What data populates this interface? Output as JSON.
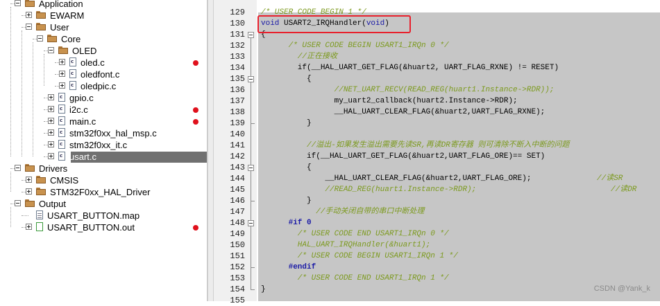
{
  "tree": {
    "items": [
      {
        "label": "Application",
        "kind": "folder",
        "expanded": true
      },
      {
        "label": "EWARM",
        "kind": "folder",
        "expanded": false
      },
      {
        "label": "User",
        "kind": "folder",
        "expanded": true
      },
      {
        "label": "Core",
        "kind": "folder",
        "expanded": true
      },
      {
        "label": "OLED",
        "kind": "folder",
        "expanded": true
      },
      {
        "label": "oled.c",
        "kind": "file",
        "expanded": false,
        "marker": true
      },
      {
        "label": "oledfont.c",
        "kind": "file",
        "expanded": false,
        "marker": false
      },
      {
        "label": "oledpic.c",
        "kind": "file",
        "expanded": false,
        "marker": false
      },
      {
        "label": "gpio.c",
        "kind": "file",
        "expanded": false,
        "marker": false
      },
      {
        "label": "i2c.c",
        "kind": "file",
        "expanded": false,
        "marker": true
      },
      {
        "label": "main.c",
        "kind": "file",
        "expanded": false,
        "marker": true
      },
      {
        "label": "stm32f0xx_hal_msp.c",
        "kind": "file",
        "expanded": false,
        "marker": false
      },
      {
        "label": "stm32f0xx_it.c",
        "kind": "file",
        "expanded": false,
        "marker": false
      },
      {
        "label": "usart.c",
        "kind": "file",
        "expanded": false,
        "marker": false,
        "selected": true
      },
      {
        "label": "Drivers",
        "kind": "folder",
        "expanded": true
      },
      {
        "label": "CMSIS",
        "kind": "folder",
        "expanded": false
      },
      {
        "label": "STM32F0xx_HAL_Driver",
        "kind": "folder",
        "expanded": false
      },
      {
        "label": "Output",
        "kind": "folder",
        "expanded": true
      },
      {
        "label": "USART_BUTTON.map",
        "kind": "map",
        "expanded": false,
        "marker": false
      },
      {
        "label": "USART_BUTTON.out",
        "kind": "out",
        "expanded": false,
        "marker": true
      }
    ]
  },
  "editor": {
    "lines": [
      {
        "num": "129",
        "text": "/* USER CODE BEGIN 1 */",
        "style": "cmt"
      },
      {
        "num": "130",
        "text": "void USART2_IRQHandler(void)",
        "style": "code"
      },
      {
        "num": "131",
        "text": "{",
        "style": "code"
      },
      {
        "num": "132",
        "text": "      /* USER CODE BEGIN USART1_IRQn 0 */",
        "style": "cmt"
      },
      {
        "num": "133",
        "text": "        //正在接收",
        "style": "cmt"
      },
      {
        "num": "134",
        "text": "        if(__HAL_UART_GET_FLAG(&huart2, UART_FLAG_RXNE) != RESET)",
        "style": "code"
      },
      {
        "num": "135",
        "text": "          {",
        "style": "code"
      },
      {
        "num": "136",
        "text": "                //NET_UART_RECV(READ_REG(huart1.Instance->RDR));",
        "style": "cmt"
      },
      {
        "num": "137",
        "text": "                my_uart2_callback(huart2.Instance->RDR);",
        "style": "code"
      },
      {
        "num": "138",
        "text": "                __HAL_UART_CLEAR_FLAG(&huart2,UART_FLAG_RXNE);",
        "style": "code"
      },
      {
        "num": "139",
        "text": "          }",
        "style": "code"
      },
      {
        "num": "140",
        "text": "",
        "style": "code"
      },
      {
        "num": "141",
        "text": "          //溢出-如果发生溢出需要先读SR,再读DR寄存器 则可清除不断入中断的问题",
        "style": "cmt"
      },
      {
        "num": "142",
        "text": "          if(__HAL_UART_GET_FLAG(&huart2,UART_FLAG_ORE)== SET)",
        "style": "code"
      },
      {
        "num": "143",
        "text": "          {",
        "style": "code"
      },
      {
        "num": "144",
        "text": "              __HAL_UART_CLEAR_FLAG(&huart2,UART_FLAG_ORE);",
        "style": "code"
      },
      {
        "num": "145",
        "text": "              //READ_REG(huart1.Instance->RDR);",
        "style": "cmt"
      },
      {
        "num": "146",
        "text": "          }",
        "style": "code"
      },
      {
        "num": "147",
        "text": "            //手动关闭自带的串口中断处理",
        "style": "cmt"
      },
      {
        "num": "148",
        "text": "      #if 0",
        "style": "pp"
      },
      {
        "num": "149",
        "text": "        /* USER CODE END USART1_IRQn 0 */",
        "style": "cmt"
      },
      {
        "num": "150",
        "text": "        HAL_UART_IRQHandler(&huart1);",
        "style": "cmt"
      },
      {
        "num": "151",
        "text": "        /* USER CODE BEGIN USART1_IRQn 1 */",
        "style": "cmt"
      },
      {
        "num": "152",
        "text": "      #endif",
        "style": "pp"
      },
      {
        "num": "153",
        "text": "        /* USER CODE END USART1_IRQn 1 */",
        "style": "cmt"
      },
      {
        "num": "154",
        "text": "}",
        "style": "code"
      },
      {
        "num": "155",
        "text": "",
        "style": "code"
      }
    ],
    "trailing_comments": {
      "144": "//读SR",
      "145": "//读DR"
    },
    "keyword_void": "void",
    "watermark": "CSDN @Yank_k"
  },
  "colors": {
    "comment": "#7c9a1e",
    "keyword": "#1a1aa6",
    "highlight_box": "#e8202c",
    "breakpoint_marker": "#e0101c",
    "selection": "#707070"
  }
}
